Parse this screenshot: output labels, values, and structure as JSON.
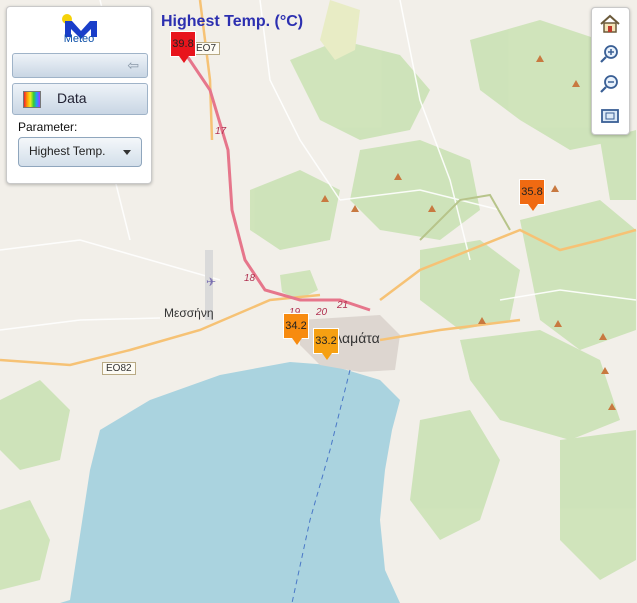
{
  "sidebar": {
    "logo_text": "Meteo",
    "data_label": "Data",
    "parameter_label": "Parameter:",
    "parameter_value": "Highest Temp."
  },
  "map": {
    "title": "Highest Temp. (°C)",
    "labels": {
      "town_west": "Μεσσήνη",
      "city": "Καλαμάτα",
      "road_e082": "ΕΟ82",
      "road_eo7": "ΕΟ7"
    },
    "road_numbers": [
      "17",
      "18",
      "19",
      "20",
      "21"
    ],
    "markers": [
      {
        "value": "39.8",
        "color": "#e8141c"
      },
      {
        "value": "35.8",
        "color": "#f06a12"
      },
      {
        "value": "34.2",
        "color": "#f78b10"
      },
      {
        "value": "33.2",
        "color": "#f6a012"
      }
    ]
  },
  "toolbar": {
    "icons": [
      "home-icon",
      "zoom-in-icon",
      "zoom-out-icon",
      "zoom-extent-icon"
    ]
  }
}
